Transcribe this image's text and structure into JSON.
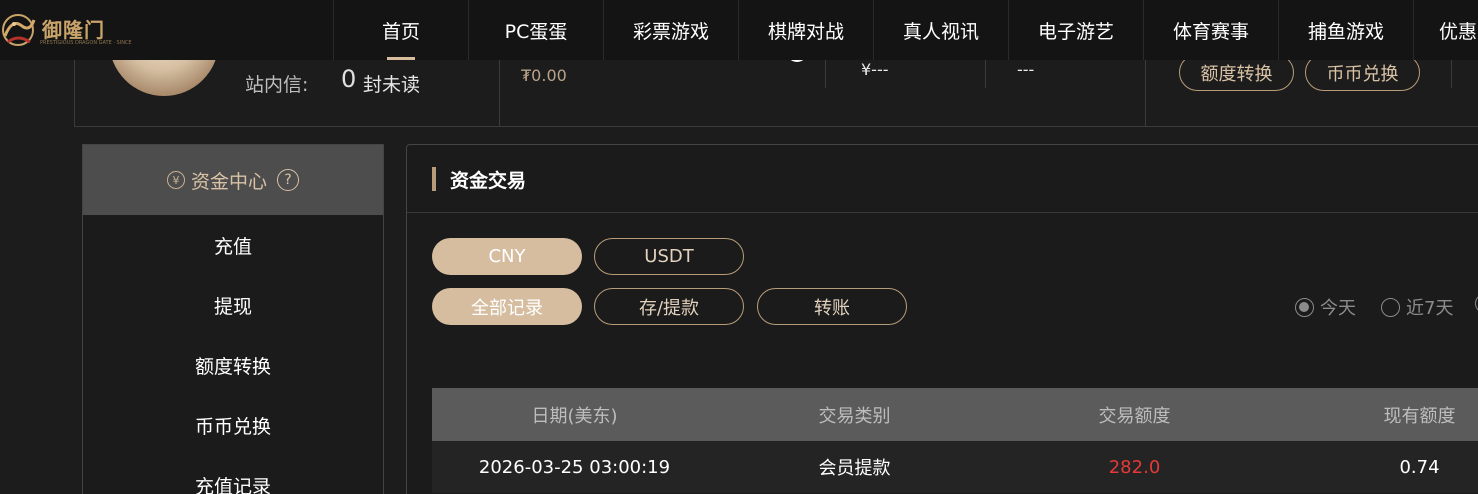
{
  "brand": {
    "name": "御隆门",
    "tagline": "PRESTIGIOUS DRAGON GATE · SINCE"
  },
  "nav": {
    "items": [
      "首页",
      "PC蛋蛋",
      "彩票游戏",
      "棋牌对战",
      "真人视讯",
      "电子游艺",
      "体育赛事",
      "捕鱼游戏",
      "优惠"
    ],
    "active_index": 0
  },
  "user": {
    "message_label": "站内信:",
    "message_count": "0",
    "message_unread_label": "封未读",
    "main_balance": "₮0.00",
    "balance_yen": "¥---",
    "balance_other": "---",
    "quota_transfer_label": "额度转换",
    "coin_exchange_label": "币币兑换"
  },
  "sidebar": {
    "title": "资金中心",
    "help": "?",
    "items": [
      "充值",
      "提现",
      "额度转换",
      "币币兑换",
      "充值记录"
    ]
  },
  "main": {
    "title": "资金交易",
    "currency_tabs": [
      {
        "label": "CNY",
        "selected": true
      },
      {
        "label": "USDT",
        "selected": false
      }
    ],
    "filter_tabs": [
      {
        "label": "全部记录",
        "selected": true
      },
      {
        "label": "存/提款",
        "selected": false
      },
      {
        "label": "转账",
        "selected": false
      }
    ],
    "date_range": [
      {
        "label": "今天",
        "selected": true
      },
      {
        "label": "近7天",
        "selected": false
      }
    ],
    "table": {
      "headers": [
        "日期(美东)",
        "交易类别",
        "交易额度",
        "现有额度"
      ],
      "rows": [
        {
          "date": "2026-03-25 03:00:19",
          "type": "会员提款",
          "amount": "282.0",
          "balance": "0.74"
        }
      ]
    }
  },
  "colors": {
    "accent": "#d6bd9f",
    "accent_border": "#b89c7a",
    "negative": "#e63939",
    "background": "#1c1c1c"
  }
}
